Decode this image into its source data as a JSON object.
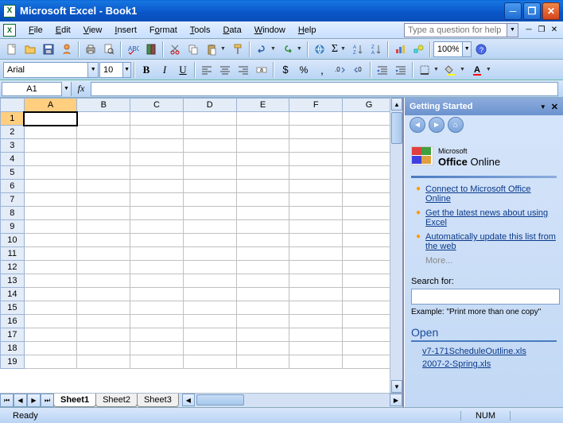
{
  "titlebar": {
    "title": "Microsoft Excel - Book1"
  },
  "menubar": {
    "items": [
      {
        "u": "F",
        "rest": "ile"
      },
      {
        "u": "E",
        "rest": "dit"
      },
      {
        "u": "V",
        "rest": "iew"
      },
      {
        "u": "I",
        "rest": "nsert"
      },
      {
        "u": "o",
        "pre": "F",
        "rest": "rmat"
      },
      {
        "u": "T",
        "rest": "ools"
      },
      {
        "u": "D",
        "rest": "ata"
      },
      {
        "u": "W",
        "rest": "indow"
      },
      {
        "u": "H",
        "rest": "elp"
      }
    ],
    "help_placeholder": "Type a question for help"
  },
  "formatting": {
    "font": "Arial",
    "size": "10"
  },
  "zoom": "100%",
  "namebox": "A1",
  "columns": [
    "A",
    "B",
    "C",
    "D",
    "E",
    "F",
    "G"
  ],
  "rows": [
    "1",
    "2",
    "3",
    "4",
    "5",
    "6",
    "7",
    "8",
    "9",
    "10",
    "11",
    "12",
    "13",
    "14",
    "15",
    "16",
    "17",
    "18",
    "19"
  ],
  "selected_cell": {
    "col": "A",
    "row": "1"
  },
  "sheets": [
    "Sheet1",
    "Sheet2",
    "Sheet3"
  ],
  "active_sheet": "Sheet1",
  "taskpane": {
    "title": "Getting Started",
    "logo_pre": "Microsoft",
    "logo_main": "Office",
    "logo_post": "Online",
    "links": [
      "Connect to Microsoft Office Online",
      "Get the latest news about using Excel",
      "Automatically update this list from the web"
    ],
    "more": "More...",
    "search_label": "Search for:",
    "example": "Example:  \"Print more than one copy\"",
    "open_title": "Open",
    "recent_files": [
      "v7-171ScheduleOutline.xls",
      "2007-2-Spring.xls"
    ]
  },
  "statusbar": {
    "ready": "Ready",
    "num": "NUM"
  }
}
